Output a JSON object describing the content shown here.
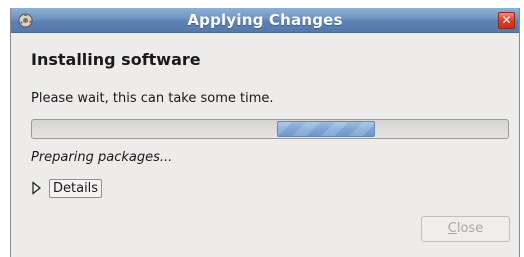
{
  "window": {
    "title": "Applying Changes",
    "app_icon": "package-installer-icon",
    "close_icon": "close-icon"
  },
  "content": {
    "heading": "Installing software",
    "message": "Please wait, this can take some time.",
    "progress": {
      "state": "indeterminate",
      "pulse_color": "#7ea5d4"
    },
    "status": "Preparing packages...",
    "details": {
      "label": "Details",
      "expanded": false,
      "arrow_icon": "triangle-right-icon"
    }
  },
  "buttons": {
    "close_mnemonic": "C",
    "close_rest": "lose",
    "close_enabled": false
  },
  "colors": {
    "titlebar": "#6f93c0",
    "close_button": "#d9402d",
    "background": "#edeceb"
  }
}
